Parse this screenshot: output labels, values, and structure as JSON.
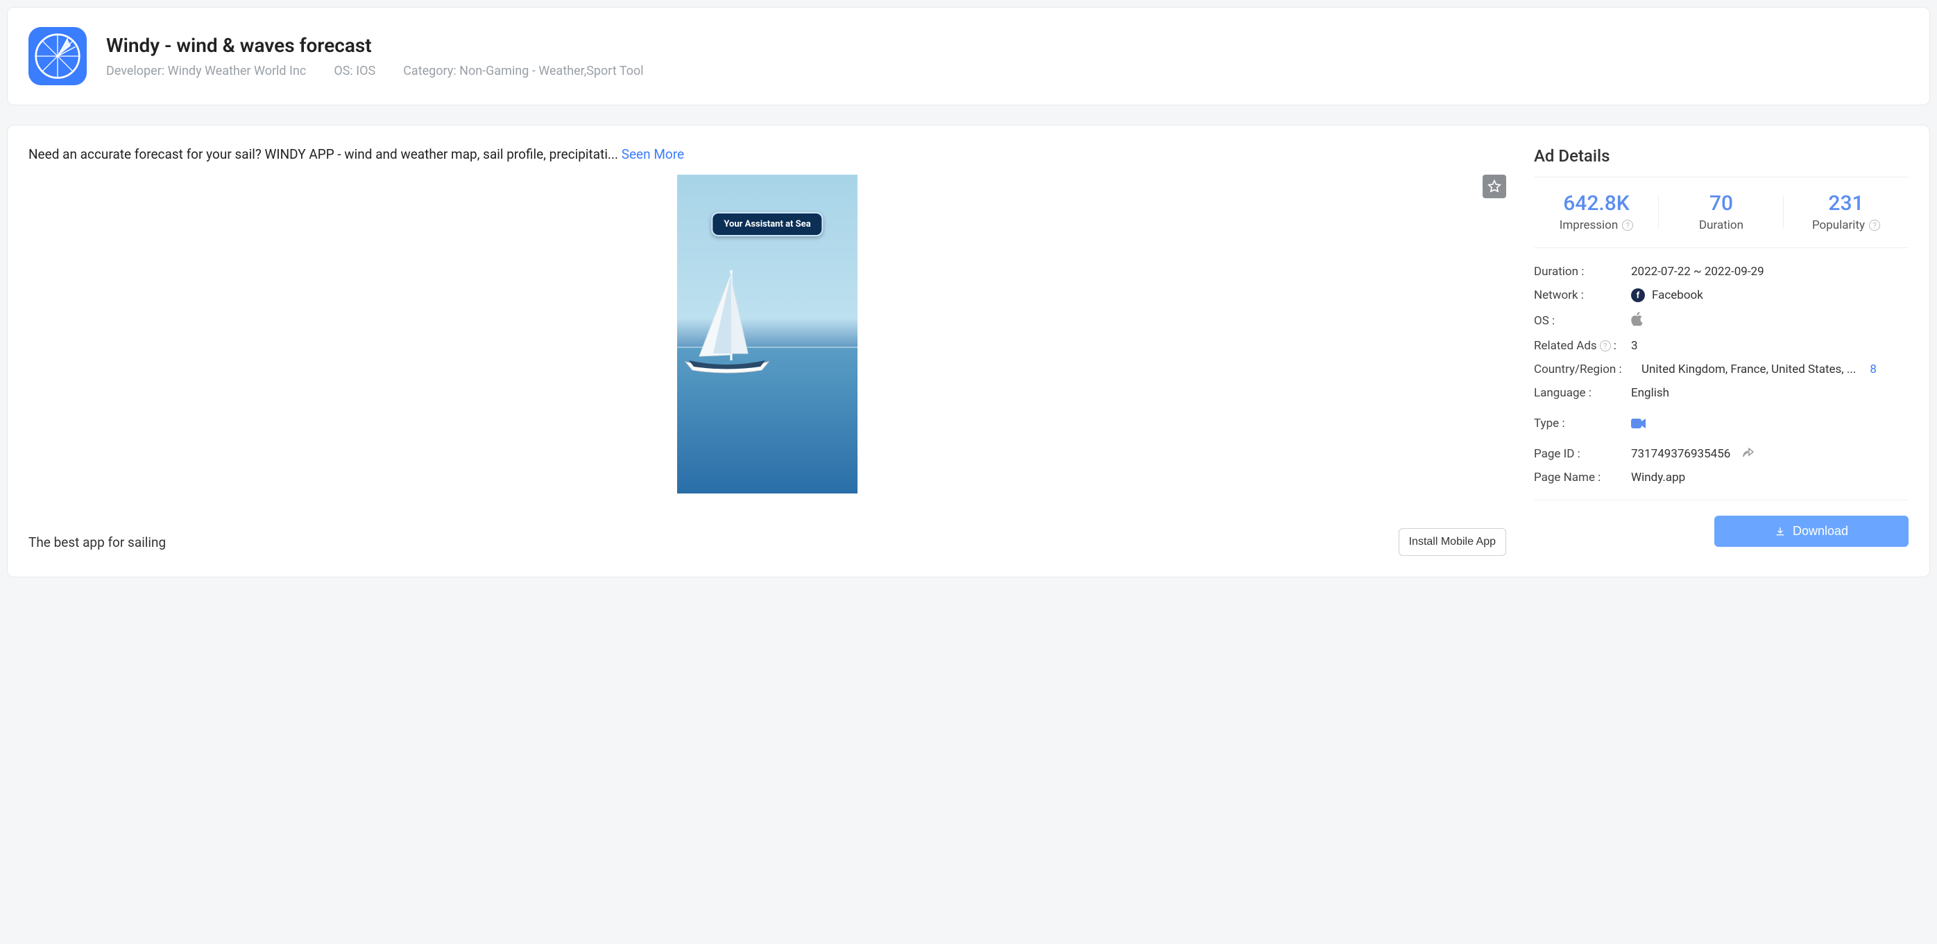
{
  "header": {
    "title": "Windy - wind & waves forecast",
    "developer_label": "Developer:",
    "developer_value": "Windy Weather World Inc",
    "os_label": "OS:",
    "os_value": "IOS",
    "category_label": "Category:",
    "category_value": "Non-Gaming - Weather,Sport Tool"
  },
  "description": {
    "text": "Need an accurate forecast for your sail? WINDY APP - wind and weather map, sail profile, precipitati... ",
    "see_more": "Seen More"
  },
  "creative": {
    "badge": "Your Assistant at Sea"
  },
  "caption": "The best app for sailing",
  "install_button": "Install Mobile App",
  "details": {
    "title": "Ad Details",
    "stats": {
      "impression": {
        "value": "642.8K",
        "label": "Impression"
      },
      "duration": {
        "value": "70",
        "label": "Duration"
      },
      "popularity": {
        "value": "231",
        "label": "Popularity"
      }
    },
    "rows": {
      "duration": {
        "label": "Duration :",
        "value": "2022-07-22 ~ 2022-09-29"
      },
      "network": {
        "label": "Network :",
        "value": "Facebook"
      },
      "os": {
        "label": "OS :"
      },
      "related": {
        "label": "Related Ads",
        "value": "3"
      },
      "country": {
        "label": "Country/Region :",
        "value": "United Kingdom, France, United States, ...",
        "count": "8"
      },
      "language": {
        "label": "Language :",
        "value": "English"
      },
      "type": {
        "label": "Type :"
      },
      "page_id": {
        "label": "Page ID :",
        "value": "731749376935456"
      },
      "page_name": {
        "label": "Page Name :",
        "value": "Windy.app"
      }
    },
    "download": "Download"
  }
}
